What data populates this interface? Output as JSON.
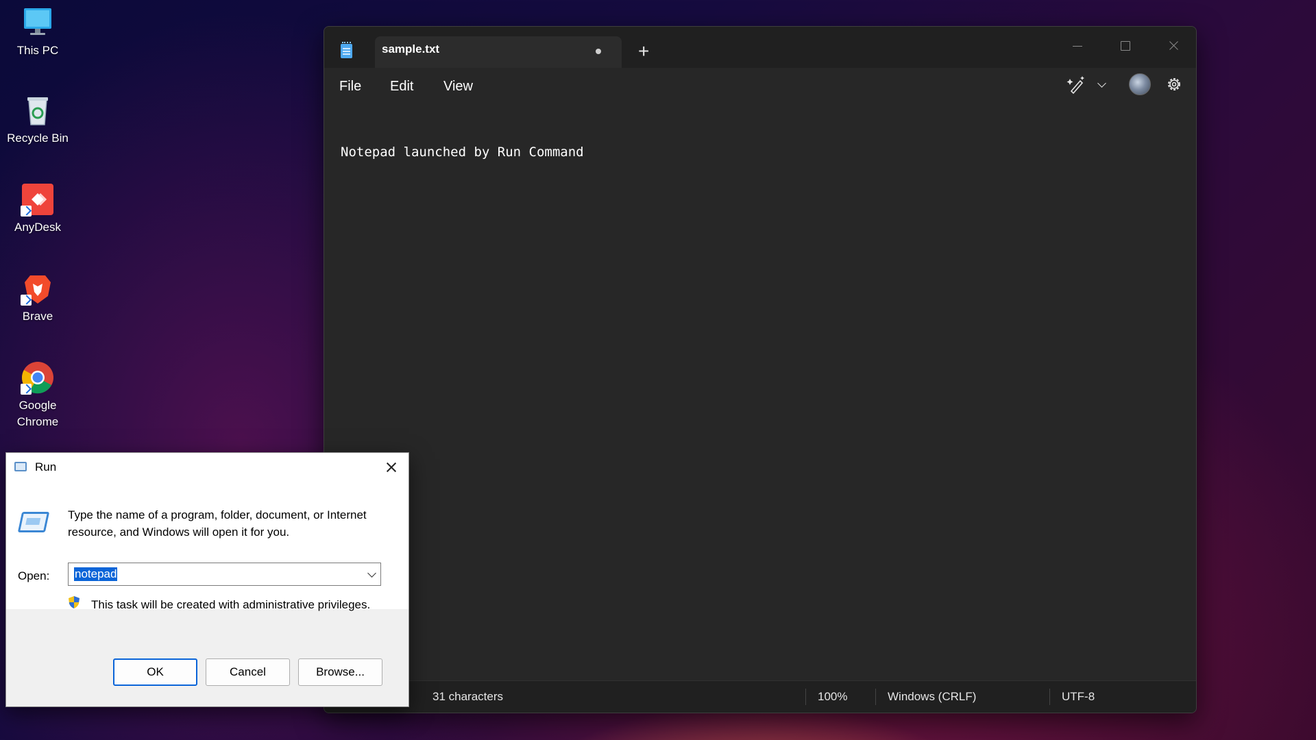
{
  "desktop": {
    "icons": [
      {
        "label": "This PC",
        "icon": "this-pc-icon"
      },
      {
        "label": "Recycle Bin",
        "icon": "recycle-bin-icon"
      },
      {
        "label": "AnyDesk",
        "icon": "anydesk-icon"
      },
      {
        "label": "Brave",
        "icon": "brave-icon"
      },
      {
        "label": "Google\nChrome",
        "icon": "chrome-icon"
      }
    ]
  },
  "notepad": {
    "tab_title": "sample.txt",
    "new_tab_glyph": "+",
    "menu": {
      "file": "File",
      "edit": "Edit",
      "view": "View"
    },
    "content": "Notepad launched by Run Command",
    "status": {
      "characters": "31 characters",
      "zoom": "100%",
      "line_ending": "Windows (CRLF)",
      "encoding": "UTF-8"
    }
  },
  "run_dialog": {
    "title": "Run",
    "description": "Type the name of a program, folder, document, or Internet resource, and Windows will open it for you.",
    "open_label": "Open:",
    "open_value": "notepad",
    "admin_note": "This task will be created with administrative privileges.",
    "buttons": {
      "ok": "OK",
      "cancel": "Cancel",
      "browse": "Browse..."
    }
  },
  "colors": {
    "accent": "#0a64d8",
    "notepad_bg": "#272727",
    "titlebar_bg": "#202020"
  }
}
